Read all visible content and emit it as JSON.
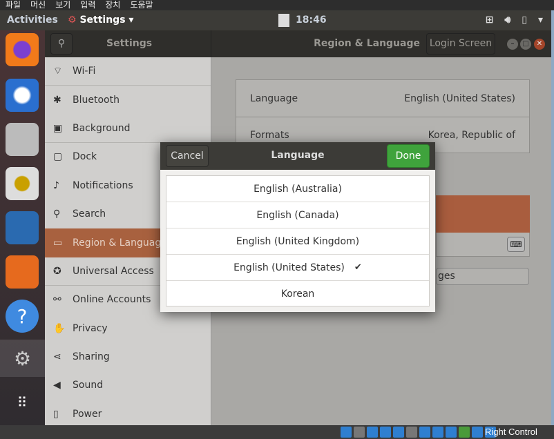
{
  "menubar": [
    "파일",
    "머신",
    "보기",
    "입력",
    "장치",
    "도움말"
  ],
  "topbar": {
    "activities": "Activities",
    "app": "Settings ▾",
    "clock": "18:46",
    "tray": [
      "network-icon",
      "volume-icon",
      "battery-icon",
      "dropdown-icon"
    ]
  },
  "dock": [
    "firefox",
    "thunderbird",
    "files",
    "rhythmbox",
    "libreoffice-writer",
    "software",
    "help",
    "settings",
    "app-grid"
  ],
  "header": {
    "title": "Settings",
    "panel": "Region & Language",
    "login": "Login Screen"
  },
  "sidebar": [
    {
      "label": "Wi-Fi",
      "icon": "wifi-icon",
      "g": "⌔"
    },
    {
      "label": "Bluetooth",
      "icon": "bluetooth-icon",
      "g": "✱"
    },
    {
      "label": "Background",
      "icon": "background-icon",
      "g": "▣"
    },
    {
      "label": "Dock",
      "icon": "dock-icon",
      "g": "▢"
    },
    {
      "label": "Notifications",
      "icon": "bell-icon",
      "g": "♪"
    },
    {
      "label": "Search",
      "icon": "search-icon",
      "g": "⚲"
    },
    {
      "label": "Region & Language",
      "icon": "region-icon",
      "g": "▭"
    },
    {
      "label": "Universal Access",
      "icon": "accessibility-icon",
      "g": "✪"
    },
    {
      "label": "Online Accounts",
      "icon": "online-accounts-icon",
      "g": "⚯"
    },
    {
      "label": "Privacy",
      "icon": "privacy-icon",
      "g": "✋"
    },
    {
      "label": "Sharing",
      "icon": "sharing-icon",
      "g": "⋖"
    },
    {
      "label": "Sound",
      "icon": "sound-icon",
      "g": "◀"
    },
    {
      "label": "Power",
      "icon": "power-icon",
      "g": "▯"
    }
  ],
  "main": {
    "language_label": "Language",
    "language_value": "English (United States)",
    "formats_label": "Formats",
    "formats_value": "Korea, Republic of",
    "button_fragment": "ges"
  },
  "dialog": {
    "cancel": "Cancel",
    "title": "Language",
    "done": "Done",
    "items": [
      "English (Australia)",
      "English (Canada)",
      "English (United Kingdom)",
      "English (United States)",
      "Korean"
    ],
    "selected": "English (United States)",
    "check": "✔"
  },
  "statusbar": {
    "host_key": "Right Control"
  },
  "colors": {
    "accent": "#a8613f",
    "done": "#3fa33c"
  }
}
